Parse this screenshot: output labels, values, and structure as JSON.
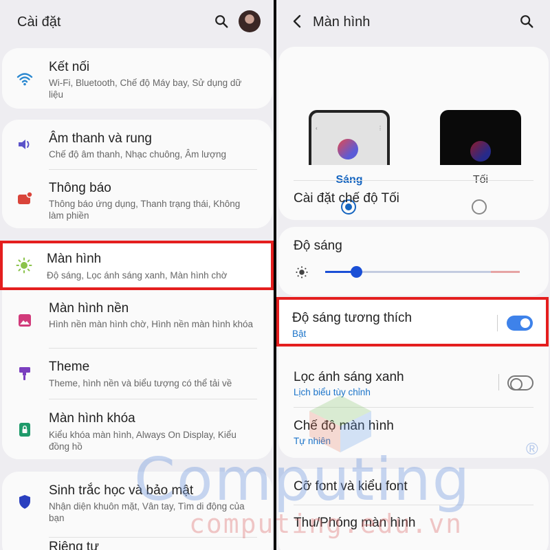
{
  "left": {
    "title": "Cài đặt",
    "sections": [
      {
        "label": "Kết nối",
        "sub": "Wi-Fi, Bluetooth, Chế độ Máy bay, Sử dụng dữ liệu",
        "icon": "wifi-icon"
      },
      {
        "label": "Âm thanh và rung",
        "sub": "Chế độ âm thanh, Nhạc chuông, Âm lượng",
        "icon": "volume-icon"
      },
      {
        "label": "Thông báo",
        "sub": "Thông báo ứng dụng, Thanh trạng thái, Không làm phiền",
        "icon": "notification-icon"
      },
      {
        "label": "Màn hình",
        "sub": "Độ sáng, Lọc ánh sáng xanh, Màn hình chờ",
        "icon": "brightness-icon"
      },
      {
        "label": "Màn hình nền",
        "sub": "Hình nền màn hình chờ, Hình nền màn hình khóa",
        "icon": "wallpaper-icon"
      },
      {
        "label": "Theme",
        "sub": "Theme, hình nền và biểu tượng có thể tải về",
        "icon": "theme-brush-icon"
      },
      {
        "label": "Màn hình khóa",
        "sub": "Kiểu khóa màn hình, Always On Display, Kiểu đồng hồ",
        "icon": "lock-screen-icon"
      },
      {
        "label": "Sinh trắc học và bảo mật",
        "sub": "Nhận diện khuôn mặt, Vân tay, Tìm di động của bạn",
        "icon": "shield-icon"
      },
      {
        "label": "Riêng tư",
        "sub": "",
        "icon": ""
      }
    ]
  },
  "right": {
    "title": "Màn hình",
    "light_label": "Sáng",
    "dark_label": "Tối",
    "selected_mode": "light",
    "dark_settings": "Cài đặt chế độ Tối",
    "brightness_label": "Độ sáng",
    "brightness_value": 0.16,
    "adaptive": {
      "label": "Độ sáng tương thích",
      "sub": "Bật",
      "on": true
    },
    "blue_light": {
      "label": "Lọc ánh sáng xanh",
      "sub": "Lịch biểu tùy chỉnh",
      "on": false
    },
    "screen_mode": {
      "label": "Chế độ màn hình",
      "sub": "Tự nhiên"
    },
    "font": {
      "label": "Cỡ font và kiểu font"
    },
    "zoom": {
      "label": "Thu/Phóng màn hình"
    }
  },
  "watermark": {
    "main": "Computing",
    "url": "computing.edu.vn",
    "mark": "®"
  },
  "colors": {
    "accent": "#1565c0",
    "highlight": "#e41e1e",
    "toggle_on": "#3e82ea"
  }
}
